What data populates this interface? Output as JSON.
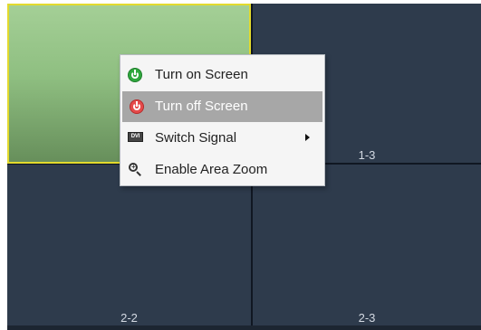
{
  "wall": {
    "tiles": [
      {
        "label": "",
        "state": "selected"
      },
      {
        "label": "1-3",
        "state": "normal"
      },
      {
        "label": "2-2",
        "state": "normal"
      },
      {
        "label": "2-3",
        "state": "normal"
      }
    ]
  },
  "context_menu": {
    "items": [
      {
        "label": "Turn on Screen",
        "icon": "power-on-icon",
        "highlighted": false
      },
      {
        "label": "Turn off Screen",
        "icon": "power-off-icon",
        "highlighted": true
      },
      {
        "label": "Switch Signal",
        "icon": "dvi-icon",
        "icon_text": "DVI",
        "has_submenu": true
      },
      {
        "label": "Enable Area Zoom",
        "icon": "zoom-icon",
        "highlighted": false
      }
    ]
  },
  "colors": {
    "selected_tile": "#8fbf81",
    "selected_border": "#e3da2d",
    "tile": "#2e3b4c",
    "menu_highlight": "#a7a7a7",
    "power_on": "#2fa83d",
    "power_off": "#e54b4b"
  }
}
